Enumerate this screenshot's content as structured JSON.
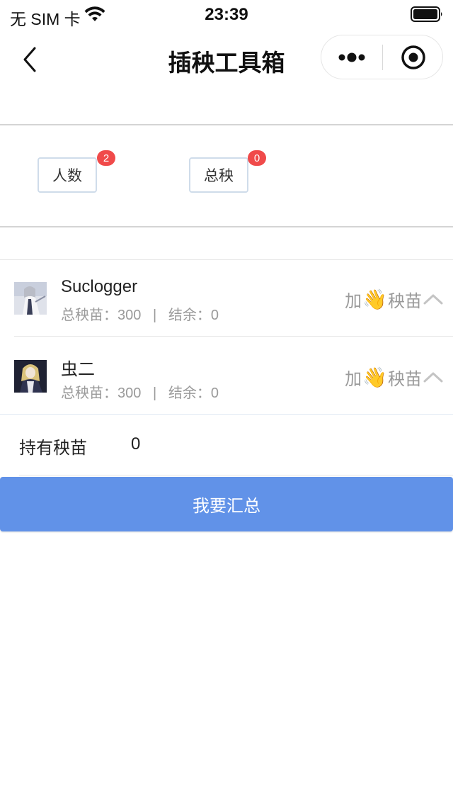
{
  "status_bar": {
    "carrier": "无 SIM 卡",
    "time": "23:39"
  },
  "nav": {
    "title": "插秧工具箱"
  },
  "counters": [
    {
      "label": "人数",
      "badge": "2"
    },
    {
      "label": "总秧",
      "badge": "0"
    }
  ],
  "players": [
    {
      "name": "Suclogger",
      "total_label": "总秧苗：",
      "total_value": "300",
      "separator": "|",
      "remain_label": "结余：",
      "remain_value": "0",
      "add_prefix": "加",
      "add_emoji": "👋",
      "add_suffix": "秧苗"
    },
    {
      "name": "虫二",
      "total_label": "总秧苗：",
      "total_value": "300",
      "separator": "|",
      "remain_label": "结余：",
      "remain_value": "0",
      "add_prefix": "加",
      "add_emoji": "👋",
      "add_suffix": "秧苗"
    }
  ],
  "holdings": {
    "label": "持有秧苗",
    "value": "0"
  },
  "summary_button": "我要汇总",
  "colors": {
    "accent": "#6192e8",
    "badge": "#f04a4a",
    "muted_text": "#9a9a9a",
    "tag_border": "#cfdcea"
  },
  "icons": {
    "back": "chevron-left-icon",
    "more": "more-dots-icon",
    "close": "target-circle-icon",
    "expand": "chevron-up-icon",
    "wifi": "wifi-icon",
    "battery": "battery-icon"
  }
}
